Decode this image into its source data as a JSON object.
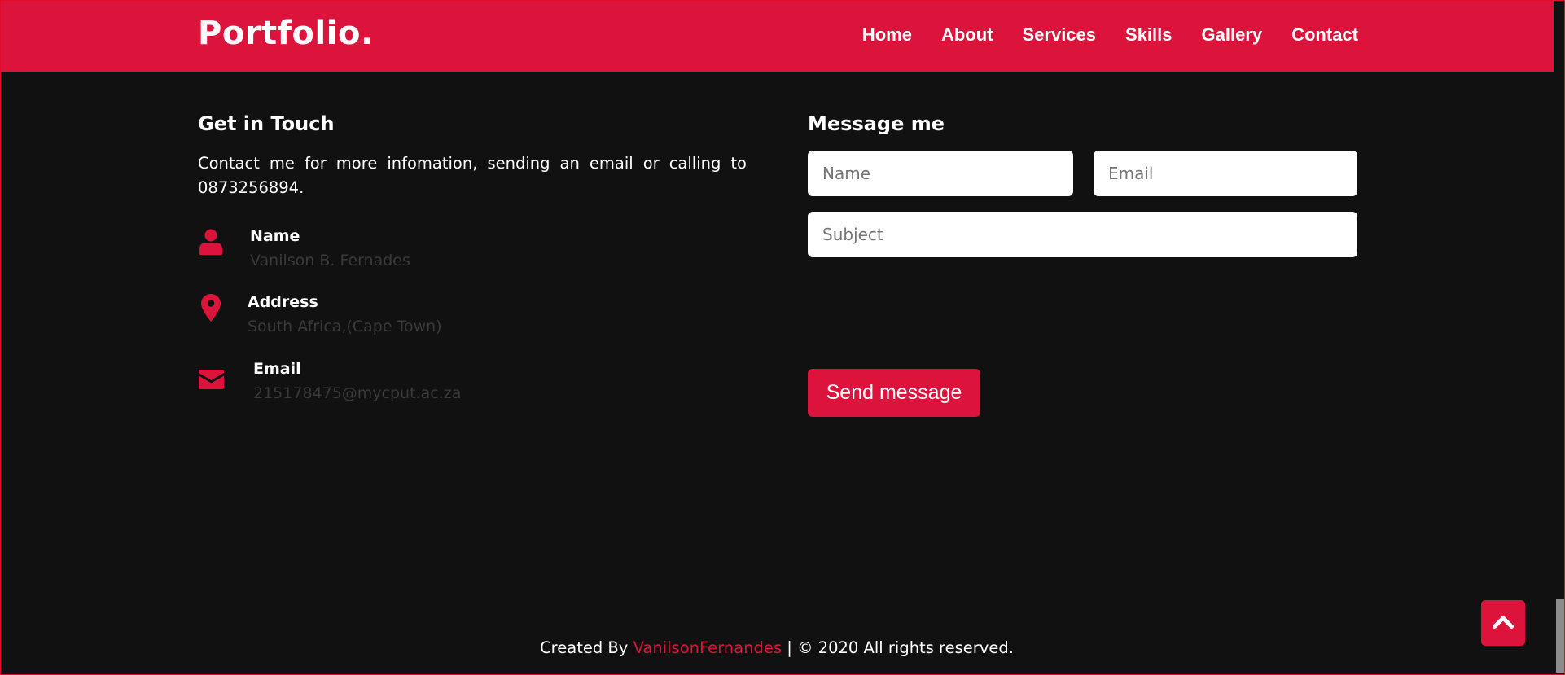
{
  "nav": {
    "logo": "Portfolio.",
    "items": [
      {
        "label": "Home"
      },
      {
        "label": "About"
      },
      {
        "label": "Services"
      },
      {
        "label": "Skills"
      },
      {
        "label": "Gallery"
      },
      {
        "label": "Contact"
      }
    ]
  },
  "contact": {
    "title": "Get in Touch",
    "intro": "Contact me for more infomation, sending an email or calling to 0873256894.",
    "info": [
      {
        "label": "Name",
        "value": "Vanilson B. Fernades",
        "icon": "user-icon"
      },
      {
        "label": "Address",
        "value": "South Africa,(Cape Town)",
        "icon": "map-marker-icon"
      },
      {
        "label": "Email",
        "value": "215178475@mycput.ac.za",
        "icon": "envelope-icon"
      }
    ]
  },
  "form": {
    "title": "Message me",
    "name_placeholder": "Name",
    "email_placeholder": "Email",
    "subject_placeholder": "Subject",
    "send_label": "Send message"
  },
  "footer": {
    "prefix": "Created By",
    "author": "VanilsonFernandes",
    "suffix": "| © 2020 All rights reserved."
  },
  "colors": {
    "accent": "#dc143c",
    "background": "#111111",
    "muted_text": "#3a3a3a"
  },
  "scroll_top": {
    "icon": "chevron-up-icon"
  }
}
